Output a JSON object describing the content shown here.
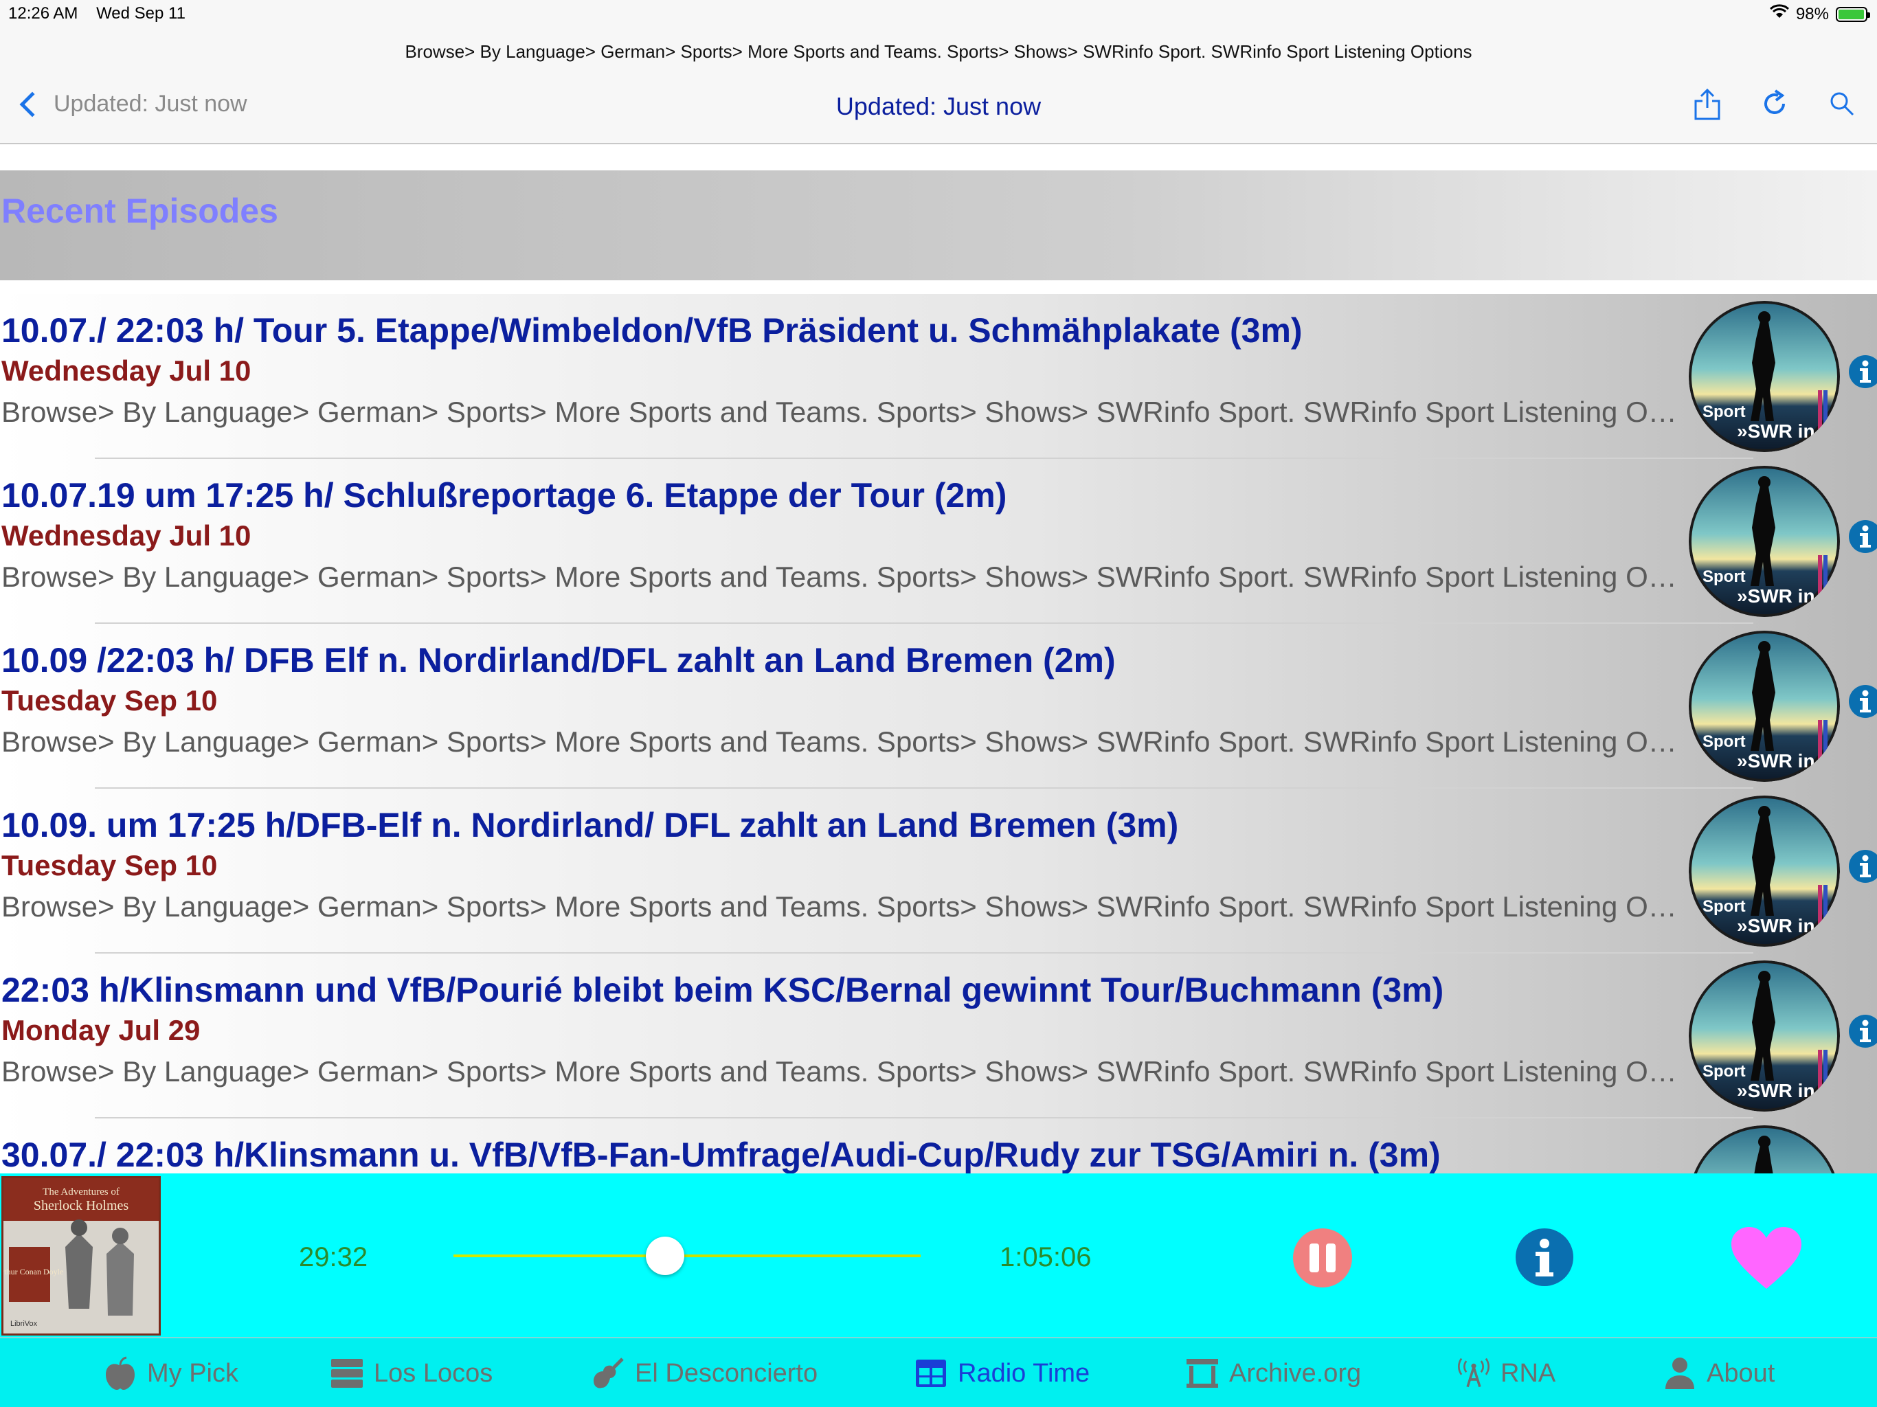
{
  "status_bar": {
    "time": "12:26 AM",
    "date": "Wed Sep 11",
    "battery_percent": "98%",
    "battery_level": 0.98
  },
  "nav": {
    "breadcrumb": "Browse> By Language> German> Sports> More Sports and Teams. Sports> Shows> SWRinfo Sport. SWRinfo Sport Listening Options",
    "back_label": "Updated: Just now",
    "title": "Updated: Just now",
    "icons": [
      "share-icon",
      "refresh-icon",
      "search-icon"
    ],
    "accent_color": "#1a73e8"
  },
  "section": {
    "title": "Recent Episodes"
  },
  "episodes": [
    {
      "title": "10.07./ 22:03 h/ Tour 5. Etappe/Wimbeldon/VfB Präsident u. Schmähplakate (3m)",
      "date": "Wednesday Jul 10",
      "path": "Browse> By Language> German> Sports> More Sports and Teams. Sports> Shows> SWRinfo Sport. SWRinfo Sport Listening Options",
      "art_label_top": "Sport",
      "art_label_bottom": "»SWR in"
    },
    {
      "title": "10.07.19 um 17:25 h/ Schlußreportage 6. Etappe der Tour (2m)",
      "date": "Wednesday Jul 10",
      "path": "Browse> By Language> German> Sports> More Sports and Teams. Sports> Shows> SWRinfo Sport. SWRinfo Sport Listening Options",
      "art_label_top": "Sport",
      "art_label_bottom": "»SWR in"
    },
    {
      "title": "10.09 /22:03 h/ DFB Elf n. Nordirland/DFL zahlt an Land Bremen (2m)",
      "date": "Tuesday Sep 10",
      "path": "Browse> By Language> German> Sports> More Sports and Teams. Sports> Shows> SWRinfo Sport. SWRinfo Sport Listening Options",
      "art_label_top": "Sport",
      "art_label_bottom": "»SWR in"
    },
    {
      "title": "10.09. um 17:25 h/DFB-Elf n. Nordirland/ DFL zahlt an Land Bremen (3m)",
      "date": "Tuesday Sep 10",
      "path": "Browse> By Language> German> Sports> More Sports and Teams. Sports> Shows> SWRinfo Sport. SWRinfo Sport Listening Options",
      "art_label_top": "Sport",
      "art_label_bottom": "»SWR in"
    },
    {
      "title": "22:03 h/Klinsmann und VfB/Pourié bleibt beim KSC/Bernal gewinnt Tour/Buchmann (3m)",
      "date": "Monday Jul 29",
      "path": "Browse> By Language> German> Sports> More Sports and Teams. Sports> Shows> SWRinfo Sport. SWRinfo Sport Listening Options",
      "art_label_top": "Sport",
      "art_label_bottom": "»SWR in"
    },
    {
      "title": "30.07./ 22:03 h/Klinsmann u. VfB/VfB-Fan-Umfrage/Audi-Cup/Rudy zur TSG/Amiri n. (3m)",
      "date": "",
      "path": "",
      "art_label_top": "",
      "art_label_bottom": ""
    }
  ],
  "player": {
    "album_title_line1": "The Adventures of",
    "album_title_line2": "Sherlock Holmes",
    "album_author": "Arthur Conan Doyle",
    "album_publisher": "LibriVox",
    "elapsed": "29:32",
    "total": "1:05:06",
    "progress": 0.4536,
    "colors": {
      "background": "#00ffff",
      "time_text": "#2c8a2c",
      "pause": "#f08080",
      "info": "#0a6fb0",
      "heart": "#ff66ff"
    }
  },
  "tabs": [
    {
      "label": "My Pick",
      "icon": "apple-icon",
      "active": false
    },
    {
      "label": "Los Locos",
      "icon": "server-stack-icon",
      "active": false
    },
    {
      "label": "El Desconcierto",
      "icon": "guitar-icon",
      "active": false
    },
    {
      "label": "Radio Time",
      "icon": "grid-table-icon",
      "active": true
    },
    {
      "label": "Archive.org",
      "icon": "archive-building-icon",
      "active": false
    },
    {
      "label": "RNA",
      "icon": "radio-antenna-icon",
      "active": false
    },
    {
      "label": "About",
      "icon": "person-icon",
      "active": false
    }
  ]
}
